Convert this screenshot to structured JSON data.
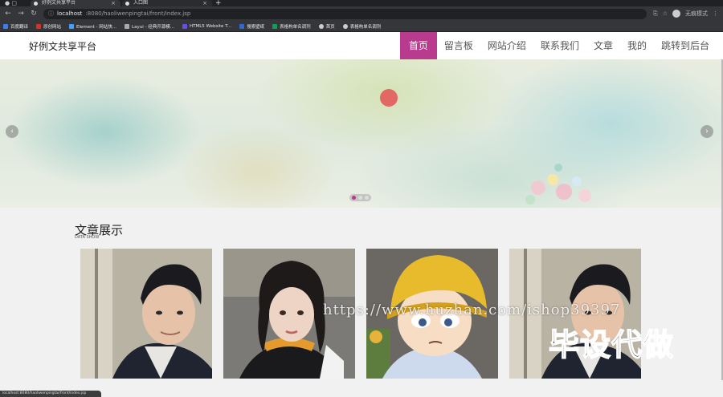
{
  "browser": {
    "tabs": [
      {
        "title": "好例文共享平台"
      },
      {
        "title": "入口图"
      }
    ],
    "new_tab": "+",
    "url_host": "localhost",
    "url_path": ":8080/haoliwenpingtai/front/index.jsp",
    "profile_label": "无痕模式",
    "bookmarks": [
      {
        "label": "百度翻译",
        "color": "#3b7ded"
      },
      {
        "label": "原创网站",
        "color": "#d93025"
      },
      {
        "label": "Element - 网站快...",
        "color": "#409eff"
      },
      {
        "label": "Layui - 经典开源模...",
        "color": "#aaaaaa"
      },
      {
        "label": "HTML5 Website T...",
        "color": "#6b4de6"
      },
      {
        "label": "搜索壁纸",
        "color": "#3367d6"
      },
      {
        "label": "表格构单名调剂",
        "color": "#0f9d58"
      },
      {
        "label": "首页",
        "color": "#cccccc"
      },
      {
        "label": "表格构单名调剂",
        "color": "#cccccc"
      }
    ]
  },
  "site": {
    "logo": "好例文共享平台",
    "menu": [
      {
        "label": "首页",
        "active": true
      },
      {
        "label": "留言板",
        "active": false
      },
      {
        "label": "网站介绍",
        "active": false
      },
      {
        "label": "联系我们",
        "active": false
      },
      {
        "label": "文章",
        "active": false
      },
      {
        "label": "我的",
        "active": false
      },
      {
        "label": "跳转到后台",
        "active": false
      }
    ],
    "accent_color": "#b93b8e"
  },
  "banner": {
    "prev_icon": "chevron-left-icon",
    "next_icon": "chevron-right-icon",
    "slide_count": 3,
    "active_slide": 1
  },
  "section": {
    "title": "文章展示",
    "subtitle": "DATA SHOW",
    "cards": [
      {
        "kind": "man"
      },
      {
        "kind": "woman"
      },
      {
        "kind": "cartoon"
      },
      {
        "kind": "man"
      }
    ]
  },
  "overlay": {
    "watermark_url": "https://www.huzhan.com/ishop39397",
    "watermark_text": "毕设代做"
  },
  "status": {
    "text": "localhost:8080/haoliwenpingtai/front/index.jsp"
  }
}
